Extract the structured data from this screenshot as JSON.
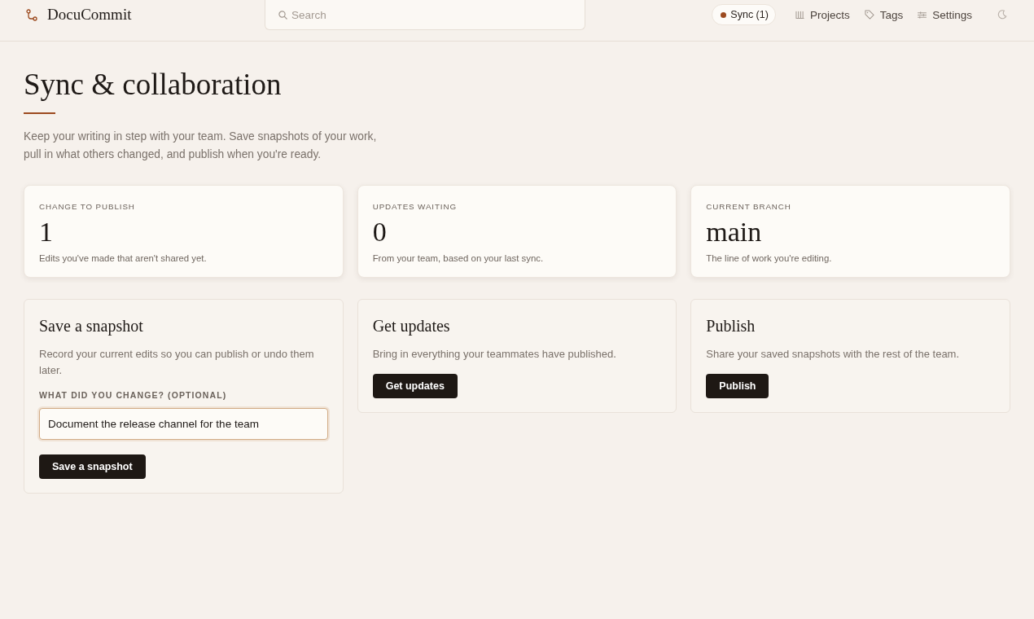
{
  "header": {
    "app_name": "DocuCommit",
    "search": {
      "placeholder": "Search"
    },
    "sync": {
      "label": "Sync (1)",
      "pending": true
    },
    "nav": [
      {
        "label": "Projects",
        "kind": "projects"
      },
      {
        "label": "Tags",
        "kind": "tags"
      },
      {
        "label": "Settings",
        "kind": "settings"
      }
    ]
  },
  "page": {
    "title": "Sync & collaboration",
    "description": "Keep your writing in step with your team. Save snapshots of your work, pull in what others changed, and publish when you're ready."
  },
  "stats": [
    {
      "label": "CHANGE TO PUBLISH",
      "value": "1",
      "note": "Edits you've made that aren't shared yet."
    },
    {
      "label": "UPDATES WAITING",
      "value": "0",
      "note": "From your team, based on your last sync."
    },
    {
      "label": "CURRENT BRANCH",
      "value": "main",
      "note": "The line of work you're editing."
    }
  ],
  "actions": [
    {
      "title": "Save a snapshot",
      "description": "Record your current edits so you can publish or undo them later.",
      "field": {
        "label": "WHAT DID YOU CHANGE? (OPTIONAL)",
        "value": "Document the release channel for the team",
        "focused": true
      },
      "button": "Save a snapshot"
    },
    {
      "title": "Get updates",
      "description": "Bring in everything your teammates have published.",
      "button": "Get updates"
    },
    {
      "title": "Publish",
      "description": "Share your saved snapshots with the rest of the team.",
      "button": "Publish"
    }
  ]
}
